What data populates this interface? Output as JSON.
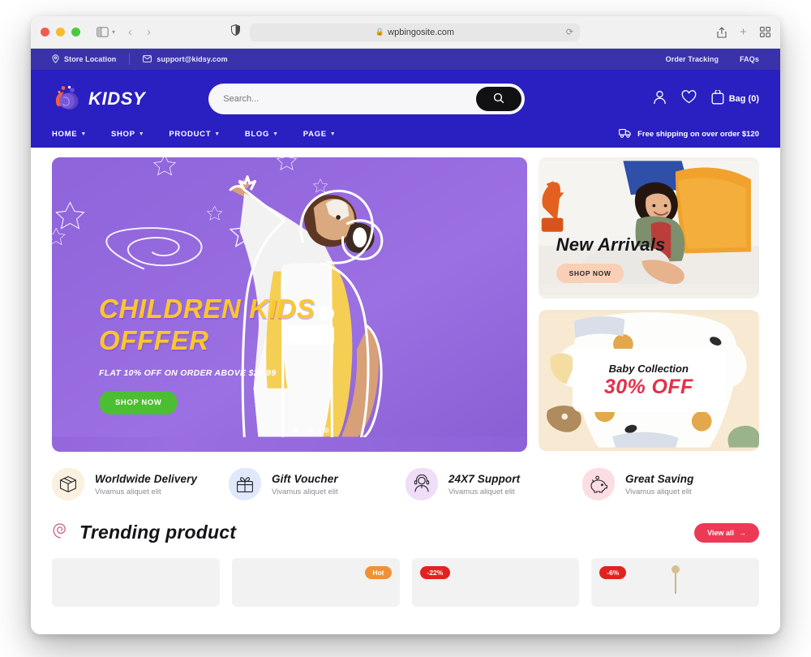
{
  "browser": {
    "url": "wpbingosite.com",
    "lock_icon": "lock-icon",
    "reload_icon": "reload-icon",
    "shield_icon": "shield-icon",
    "sidebar_icon": "sidebar-icon",
    "back_icon": "chevron-left-icon",
    "forward_icon": "chevron-right-icon",
    "share_icon": "share-icon",
    "new_tab_icon": "plus-icon",
    "tab_overview_icon": "grid-icon"
  },
  "topbar": {
    "store_location": "Store Location",
    "email": "support@kidsy.com",
    "order_tracking": "Order Tracking",
    "faqs": "FAQs",
    "location_icon": "map-pin-icon",
    "mail_icon": "envelope-icon"
  },
  "header": {
    "brand": "KIDSY",
    "search_placeholder": "Search...",
    "search_value": "",
    "search_icon": "search-icon",
    "account_icon": "user-icon",
    "wishlist_icon": "heart-icon",
    "bag_icon": "bag-icon",
    "bag_label": "Bag (0)",
    "shipping_icon": "truck-icon",
    "shipping_text": "Free shipping on over order $120",
    "nav": [
      {
        "label": "HOME",
        "caret": "⌄"
      },
      {
        "label": "SHOP",
        "caret": "⌄"
      },
      {
        "label": "PRODUCT",
        "caret": "⌄"
      },
      {
        "label": "BLOG",
        "caret": "⌄"
      },
      {
        "label": "PAGE",
        "caret": "⌄"
      }
    ]
  },
  "hero": {
    "title_line1": "CHILDREN KIDS",
    "title_line2": "OFFFER",
    "subtitle": "FLAT 10% OFF ON ORDER ABOVE $29.99",
    "button": "SHOP NOW",
    "slide_count": 3,
    "active_slide": 1
  },
  "promos": {
    "new_arrivals": {
      "title": "New Arrivals",
      "button": "SHOP NOW"
    },
    "baby_collection": {
      "line1": "Baby Collection",
      "line2": "30% OFF"
    }
  },
  "features": [
    {
      "title": "Worldwide Delivery",
      "subtitle": "Vivamus aliquet elit",
      "icon": "box-icon"
    },
    {
      "title": "Gift Voucher",
      "subtitle": "Vivamus aliquet elit",
      "icon": "gift-icon"
    },
    {
      "title": "24X7 Support",
      "subtitle": "Vivamus aliquet elit",
      "icon": "headset-agent-icon"
    },
    {
      "title": "Great Saving",
      "subtitle": "Vivamus aliquet elit",
      "icon": "piggy-bank-icon"
    }
  ],
  "trending": {
    "title": "Trending product",
    "title_icon": "spiral-icon",
    "view_all": "View all",
    "view_all_arrow": "→",
    "cards": [
      {
        "badge": "",
        "badge_type": "none"
      },
      {
        "badge": "Hot",
        "badge_type": "hot"
      },
      {
        "badge": "-22%",
        "badge_type": "sale"
      },
      {
        "badge": "-6%",
        "badge_type": "sale"
      }
    ]
  },
  "colors": {
    "topbar_blue": "#3a32ab",
    "header_blue": "#2a1fc0",
    "hero_purple": "#9a6ee0",
    "hero_yellow": "#fcc62d",
    "green": "#4cbe32",
    "red": "#ec3a55",
    "orange": "#f09233",
    "sale_red": "#e32121"
  }
}
